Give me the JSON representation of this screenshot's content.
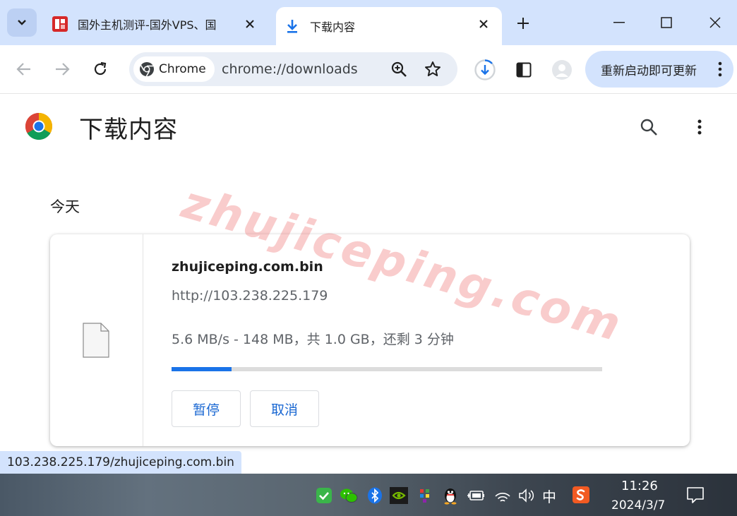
{
  "tabs": [
    {
      "title": "国外主机测评-国外VPS、国",
      "active": false
    },
    {
      "title": "下载内容",
      "active": true
    }
  ],
  "toolbar": {
    "chip_label": "Chrome",
    "url": "chrome://downloads",
    "update_label": "重新启动即可更新"
  },
  "page": {
    "title": "下载内容",
    "section_date": "今天"
  },
  "download": {
    "filename": "zhujiceping.com.bin",
    "source_url": "http://103.238.225.179",
    "status": "5.6 MB/s - 148 MB，共 1.0 GB，还剩 3 分钟",
    "progress": 0.14,
    "pause_label": "暂停",
    "cancel_label": "取消"
  },
  "watermark": "zhujiceping.com",
  "statusbar": {
    "link": "103.238.225.179/zhujiceping.com.bin"
  },
  "taskbar": {
    "ime": "中",
    "time": "11:26",
    "date": "2024/3/7"
  },
  "colors": {
    "accent": "#1a73e8",
    "tabstrip": "#d3e3fd",
    "watermark": "#ec5f5f"
  }
}
